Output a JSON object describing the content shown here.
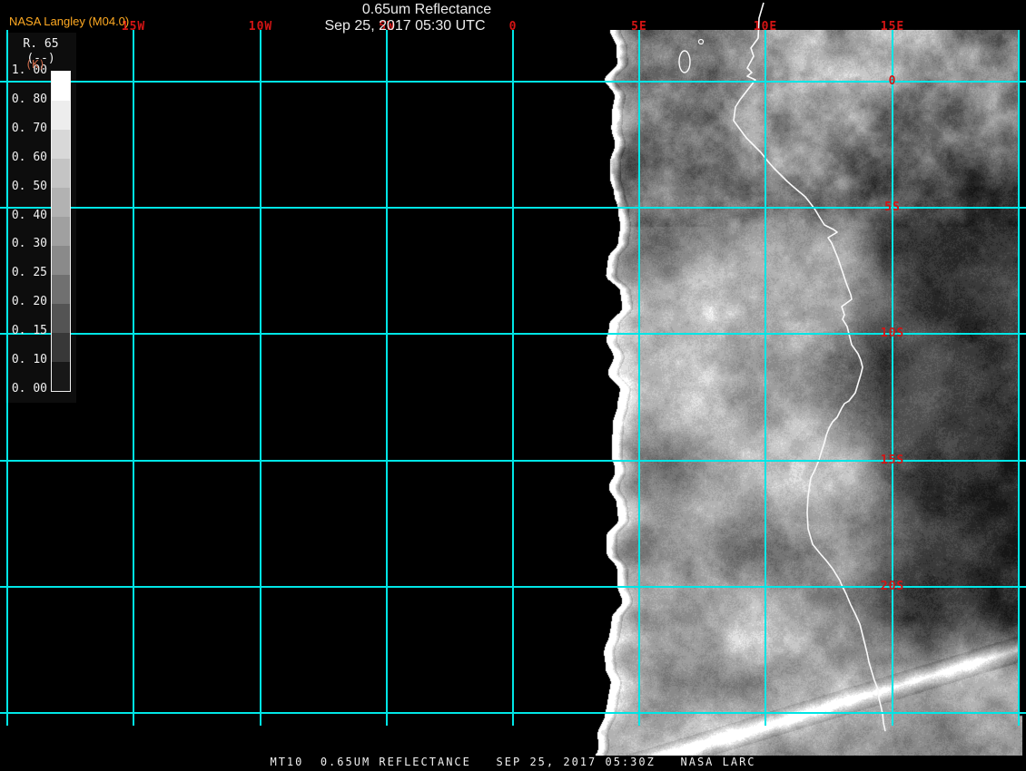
{
  "header": {
    "source_label": "NASA Langley (M04.0)",
    "title": "0.65um Reflectance",
    "subtitle": "Sep 25, 2017 05:30 UTC"
  },
  "colorbar": {
    "name": "R. 65",
    "units": "(--)",
    "units_overlay": "(K)",
    "tick_labels": [
      "1. 00",
      "0. 80",
      "0. 70",
      "0. 60",
      "0. 50",
      "0. 40",
      "0. 30",
      "0. 25",
      "0. 20",
      "0. 15",
      "0. 10",
      "0. 00"
    ],
    "segment_colors": [
      "#ffffff",
      "#ededed",
      "#d8d8d8",
      "#c4c4c4",
      "#b2b2b2",
      "#a0a0a0",
      "#8a8a8a",
      "#707070",
      "#545454",
      "#383838",
      "#181818"
    ]
  },
  "grid": {
    "line_color": "#00e6e6",
    "label_color": "#d41414",
    "lon_lines_deg": [
      -20,
      -15,
      -10,
      -5,
      0,
      5,
      10,
      15,
      20
    ],
    "lat_lines_deg": [
      0,
      5,
      10,
      15,
      20,
      25
    ],
    "lon_labels": [
      {
        "text": "15W",
        "deg": -15
      },
      {
        "text": "10W",
        "deg": -10
      },
      {
        "text": "5W",
        "deg": -5
      },
      {
        "text": "0",
        "deg": 0
      },
      {
        "text": "5E",
        "deg": 5
      },
      {
        "text": "10E",
        "deg": 10
      },
      {
        "text": "15E",
        "deg": 15
      }
    ],
    "lat_labels": [
      {
        "text": "0",
        "deg": 0
      },
      {
        "text": "5S",
        "deg": 5
      },
      {
        "text": "10S",
        "deg": 10
      },
      {
        "text": "15S",
        "deg": 15
      },
      {
        "text": "20S",
        "deg": 20
      }
    ]
  },
  "footer": {
    "caption": "MT10  0.65UM REFLECTANCE   SEP 25, 2017 05:30Z   NASA LARC"
  }
}
